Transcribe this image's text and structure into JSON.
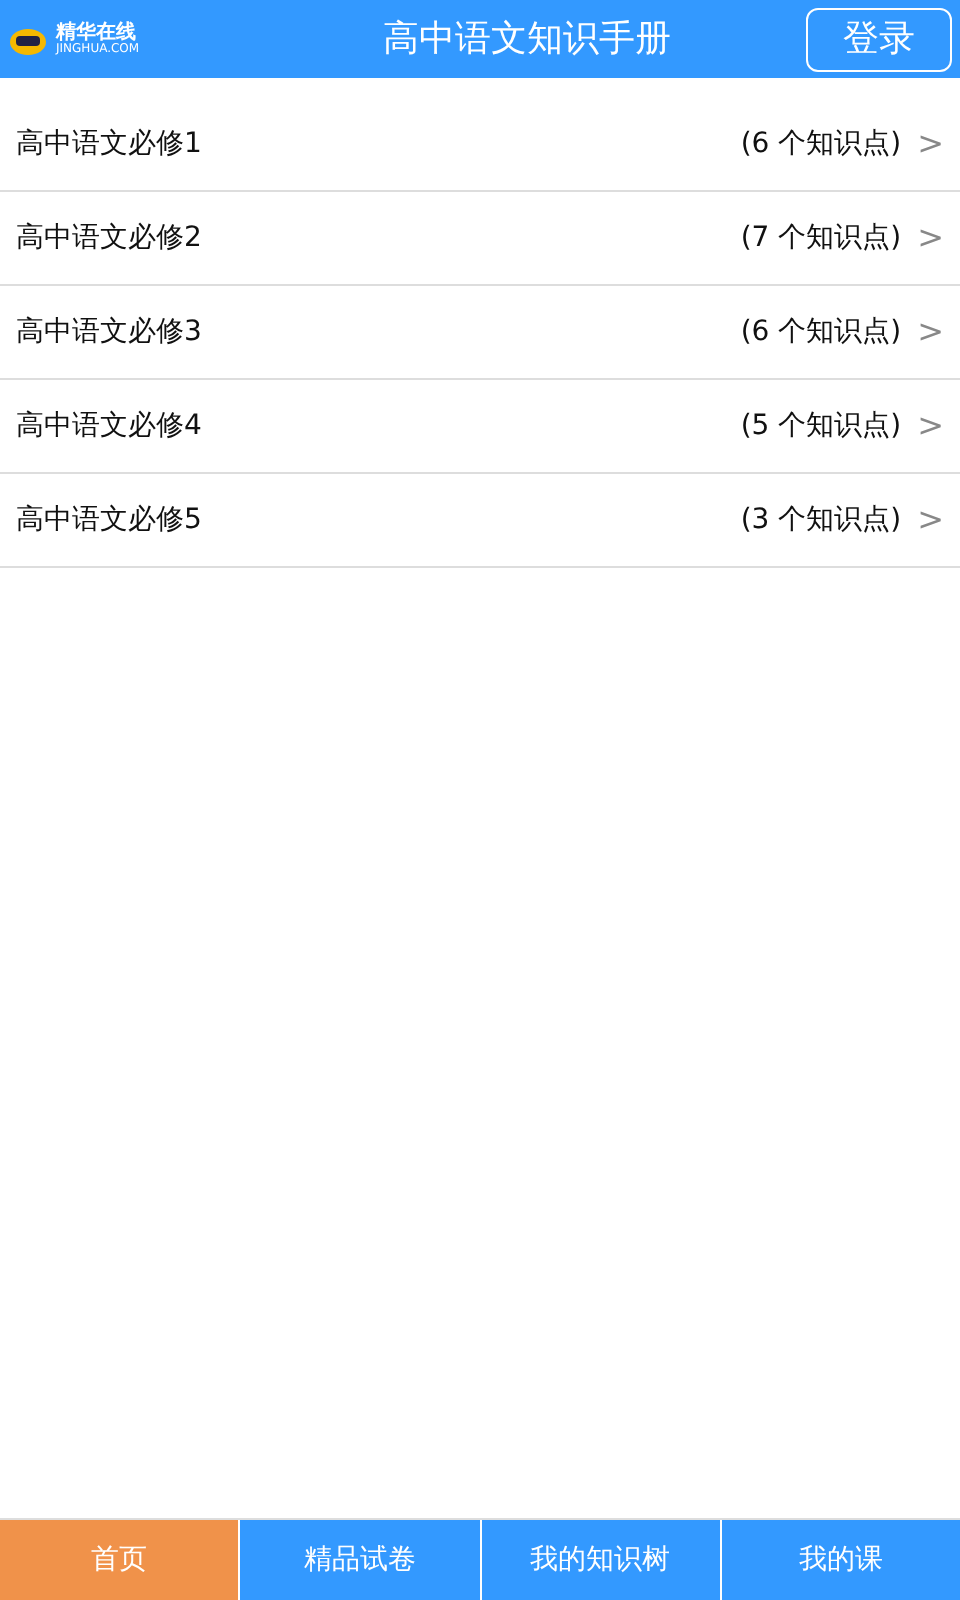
{
  "header": {
    "logo_name": "精华在线",
    "logo_domain": "JINGHUA.COM",
    "title": "高中语文知识手册",
    "login_button": "登录"
  },
  "list": [
    {
      "label": "高中语文必修1",
      "count": "(6 个知识点)",
      "chevron": ">"
    },
    {
      "label": "高中语文必修2",
      "count": "(7 个知识点)",
      "chevron": ">"
    },
    {
      "label": "高中语文必修3",
      "count": "(6 个知识点)",
      "chevron": ">"
    },
    {
      "label": "高中语文必修4",
      "count": "(5 个知识点)",
      "chevron": ">"
    },
    {
      "label": "高中语文必修5",
      "count": "(3 个知识点)",
      "chevron": ">"
    }
  ],
  "tabs": [
    {
      "label": "首页",
      "selected": true
    },
    {
      "label": "精品试卷",
      "selected": false
    },
    {
      "label": "我的知识树",
      "selected": false
    },
    {
      "label": "我的课",
      "selected": false
    }
  ]
}
